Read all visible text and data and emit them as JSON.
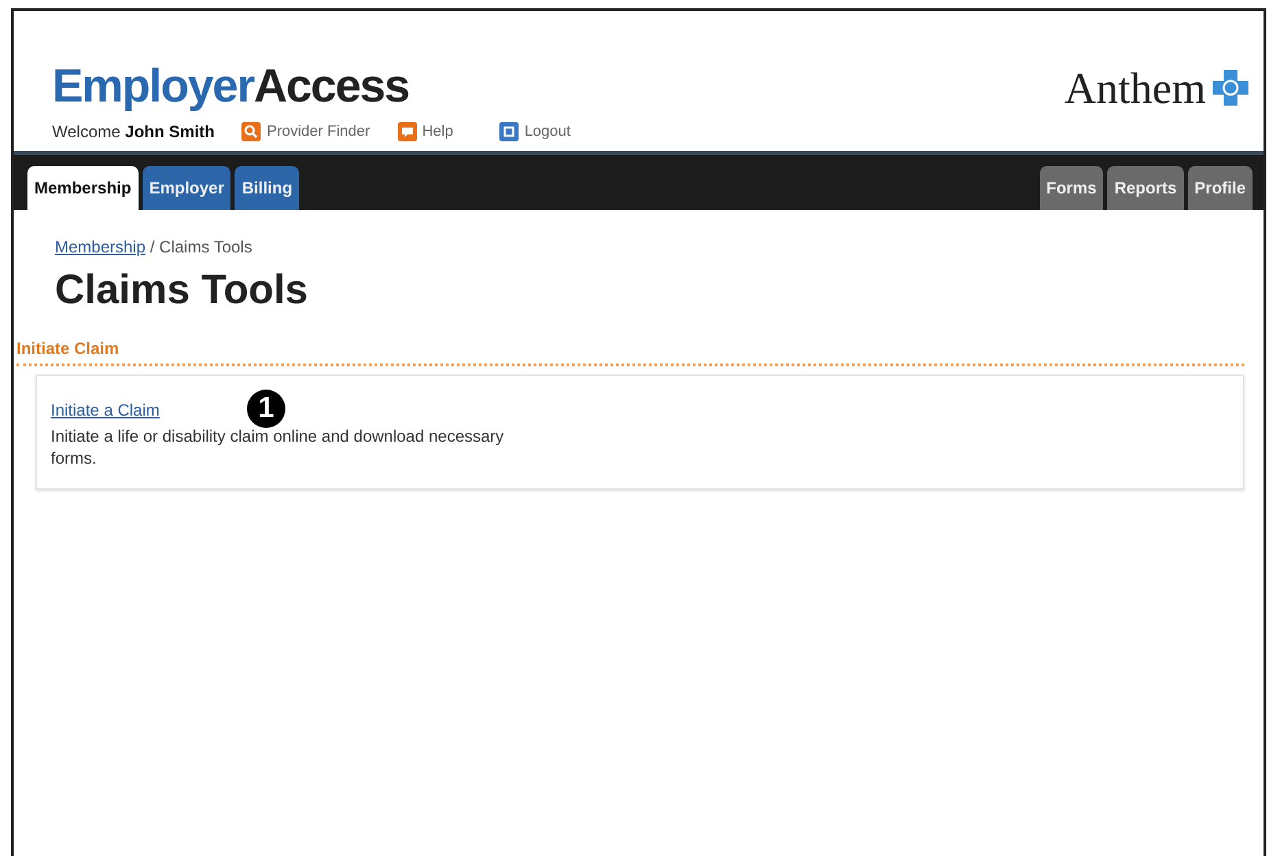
{
  "logo": {
    "first": "Employer",
    "second": "Access"
  },
  "brand": {
    "name": "Anthem"
  },
  "welcome": {
    "greeting": "Welcome",
    "user": "John Smith"
  },
  "header_links": [
    {
      "label": "Provider Finder",
      "kind": "search"
    },
    {
      "label": "Help",
      "kind": "help"
    },
    {
      "label": "Logout",
      "kind": "logout"
    }
  ],
  "tabs_left": [
    {
      "label": "Membership",
      "selected": true
    },
    {
      "label": "Employer",
      "selected": false
    },
    {
      "label": "Billing",
      "selected": false
    }
  ],
  "tabs_right": [
    {
      "label": "Forms",
      "selected": false
    },
    {
      "label": "Reports",
      "selected": false
    },
    {
      "label": "Profile",
      "selected": false
    }
  ],
  "breadcrumb": {
    "link": "Membership",
    "current": "/ Claims Tools"
  },
  "page_title": "Claims Tools",
  "section": {
    "title": "Initiate Claim",
    "items": [
      {
        "link": "Initiate a Claim",
        "description": "Initiate a life or disability claim online and download necessary forms."
      }
    ]
  },
  "callout": "1"
}
